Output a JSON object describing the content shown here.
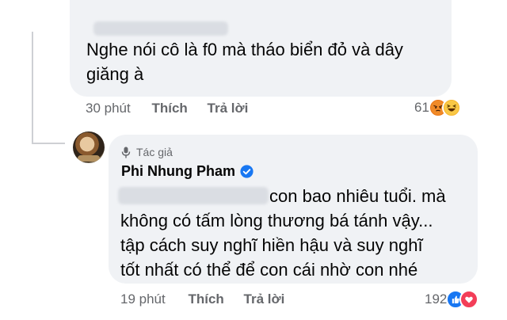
{
  "comment1": {
    "text": "Nghe nói cô là f0 mà tháo biển đỏ và dây giăng à",
    "line1": "Nghe nói cô là f0 mà tháo biển đỏ và dây",
    "line2": "giăng à",
    "time": "30 phút",
    "like_label": "Thích",
    "reply_label": "Trả lời",
    "reaction_count": "61",
    "reactions": [
      "angry-icon",
      "haha-icon"
    ]
  },
  "reply": {
    "author_badge": "Tác giả",
    "author_name": "Phi Nhung Pham",
    "line1": "con bao nhiêu tuổi. mà",
    "line2": "không có tấm lòng thương bá tánh vậy...",
    "line3": "tập cách suy nghĩ hiền hậu và suy nghĩ",
    "line4": "tốt nhất có thể để con cái nhờ con nhé",
    "time": "19 phút",
    "like_label": "Thích",
    "reply_label": "Trả lời",
    "reaction_count": "192",
    "reactions": [
      "like-icon",
      "heart-icon"
    ]
  },
  "colors": {
    "bubble": "#f0f2f5",
    "meta": "#65676b",
    "verified": "#1877f2"
  }
}
